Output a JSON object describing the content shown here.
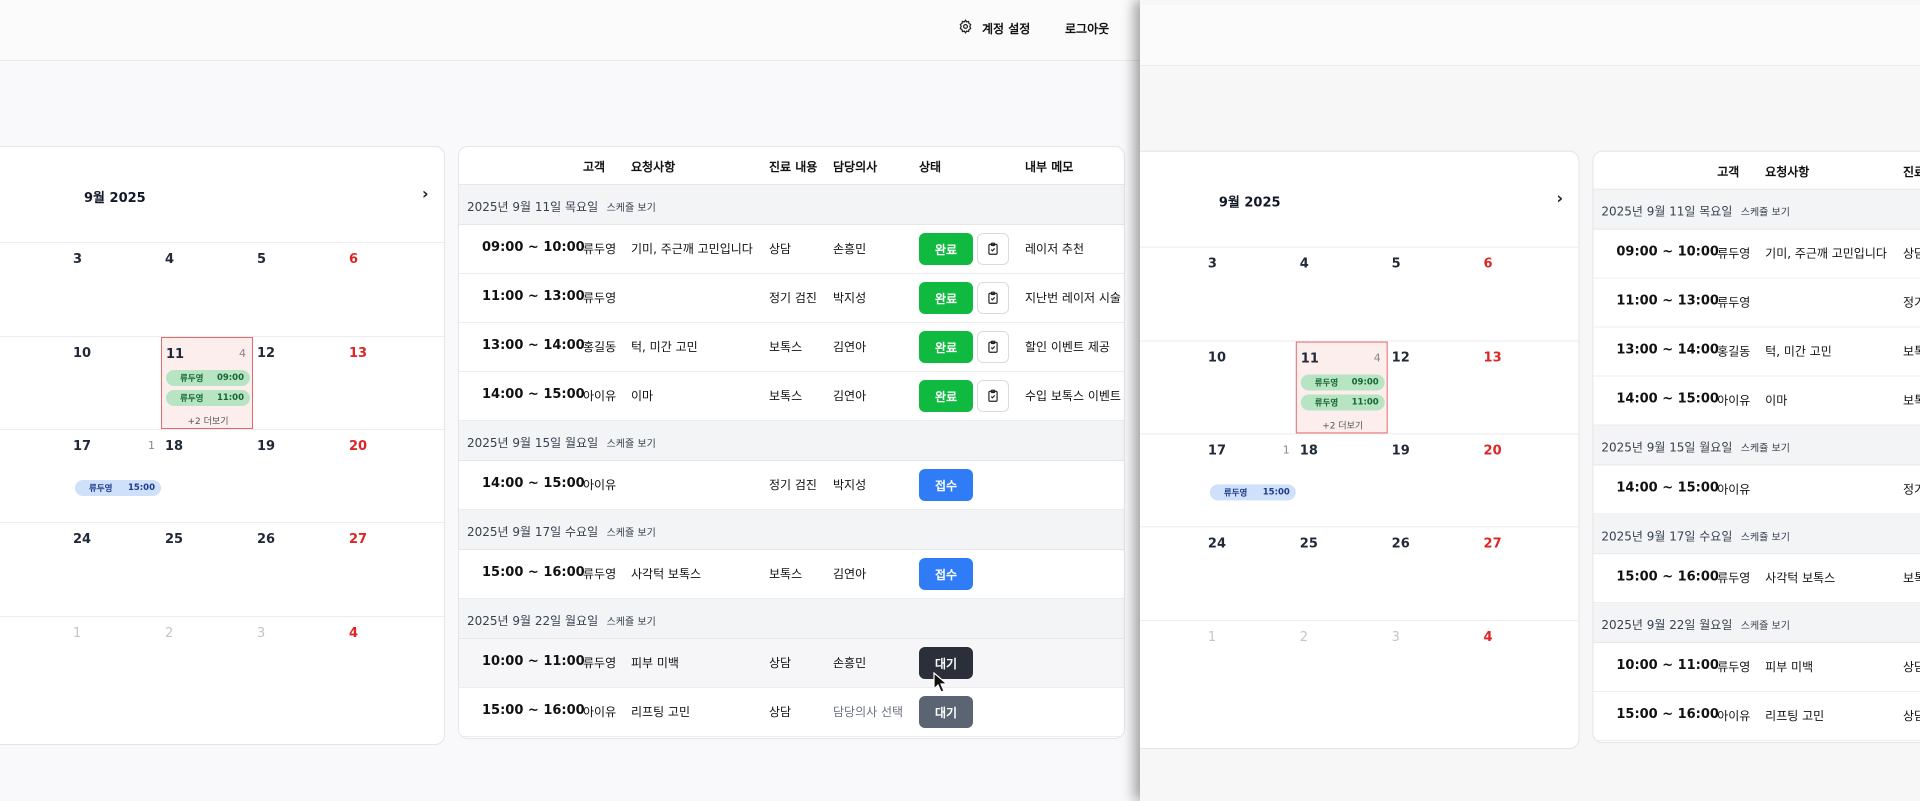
{
  "header": {
    "settings_label": "계정 설정",
    "logout_label": "로그아웃"
  },
  "calendar": {
    "month_label": "9월 2025",
    "next_icon": "chevron-right-icon",
    "weeks": [
      [
        {
          "day": "3",
          "sun": false
        },
        {
          "day": "4",
          "sun": false
        },
        {
          "day": "5",
          "sun": false
        },
        {
          "day": "6",
          "sun": true
        }
      ],
      [
        {
          "day": "10",
          "sun": false
        },
        {
          "day": "11",
          "sun": false,
          "selected": true,
          "count": "4",
          "events": [
            {
              "name": "류두영",
              "time": "09:00"
            },
            {
              "name": "류두영",
              "time": "11:00"
            }
          ],
          "more": "+2 더보기"
        },
        {
          "day": "12",
          "sun": false
        },
        {
          "day": "13",
          "sun": true
        }
      ],
      [
        {
          "day": "17",
          "sun": false,
          "count": "1",
          "events_blue": [
            {
              "name": "류두영",
              "time": "15:00"
            }
          ]
        },
        {
          "day": "18",
          "sun": false
        },
        {
          "day": "19",
          "sun": false
        },
        {
          "day": "20",
          "sun": true
        }
      ],
      [
        {
          "day": "24",
          "sun": false
        },
        {
          "day": "25",
          "sun": false
        },
        {
          "day": "26",
          "sun": false
        },
        {
          "day": "27",
          "sun": true
        }
      ],
      [
        {
          "day": "1",
          "sun": false,
          "muted": true
        },
        {
          "day": "2",
          "sun": false,
          "muted": true
        },
        {
          "day": "3",
          "sun": false,
          "muted": true
        },
        {
          "day": "4",
          "sun": true,
          "muted": true
        }
      ]
    ]
  },
  "table": {
    "headers": [
      "고객",
      "요청사항",
      "진료 내용",
      "담당의사",
      "상태",
      "내부 메모"
    ],
    "schedule_link": "스케쥴 보기",
    "groups": [
      {
        "date": "2025년 9월 11일 목요일",
        "rows": [
          {
            "time": "09:00 ~ 10:00",
            "customer": "류두영",
            "request": "기미, 주근깨 고민입니다",
            "treatment": "상담",
            "doctor": "손흥민",
            "status": "완료",
            "status_color": "green",
            "memo_icon": true,
            "memo": "레이저 추천"
          },
          {
            "time": "11:00 ~ 13:00",
            "customer": "류두영",
            "request": "",
            "treatment": "정기 검진",
            "doctor": "박지성",
            "status": "완료",
            "status_color": "green",
            "memo_icon": true,
            "memo": "지난번 레이저 시술"
          },
          {
            "time": "13:00 ~ 14:00",
            "customer": "홍길동",
            "request": "턱, 미간 고민",
            "treatment": "보톡스",
            "doctor": "김연아",
            "status": "완료",
            "status_color": "green",
            "memo_icon": true,
            "memo": "할인 이벤트 제공"
          },
          {
            "time": "14:00 ~ 15:00",
            "customer": "아이유",
            "request": "이마",
            "treatment": "보톡스",
            "doctor": "김연아",
            "status": "완료",
            "status_color": "green",
            "memo_icon": true,
            "memo": "수입 보톡스 이벤트"
          }
        ]
      },
      {
        "date": "2025년 9월 15일 월요일",
        "rows": [
          {
            "time": "14:00 ~ 15:00",
            "customer": "아이유",
            "request": "",
            "treatment": "정기 검진",
            "doctor": "박지성",
            "status": "접수",
            "status_color": "blue",
            "memo_icon": false,
            "memo": ""
          }
        ]
      },
      {
        "date": "2025년 9월 17일 수요일",
        "rows": [
          {
            "time": "15:00 ~ 16:00",
            "customer": "류두영",
            "request": "사각턱 보톡스",
            "treatment": "보톡스",
            "doctor": "김연아",
            "status": "접수",
            "status_color": "blue",
            "memo_icon": false,
            "memo": ""
          }
        ]
      },
      {
        "date": "2025년 9월 22일 월요일",
        "rows": [
          {
            "time": "10:00 ~ 11:00",
            "customer": "류두영",
            "request": "피부 미백",
            "treatment": "상담",
            "doctor": "손흥민",
            "status": "대기",
            "status_color": "dark",
            "memo_icon": false,
            "memo": ""
          },
          {
            "time": "15:00 ~ 16:00",
            "customer": "아이유",
            "request": "리프팅 고민",
            "treatment": "상담",
            "doctor": "담당의사 선택",
            "doctor_muted": true,
            "status": "대기",
            "status_color": "slate",
            "memo_icon": false,
            "memo": ""
          }
        ]
      }
    ]
  },
  "colors": {
    "complete": "#10b93f",
    "received": "#2f7cf6",
    "waiting": "#5b6473",
    "sunday": "#dc2626"
  }
}
